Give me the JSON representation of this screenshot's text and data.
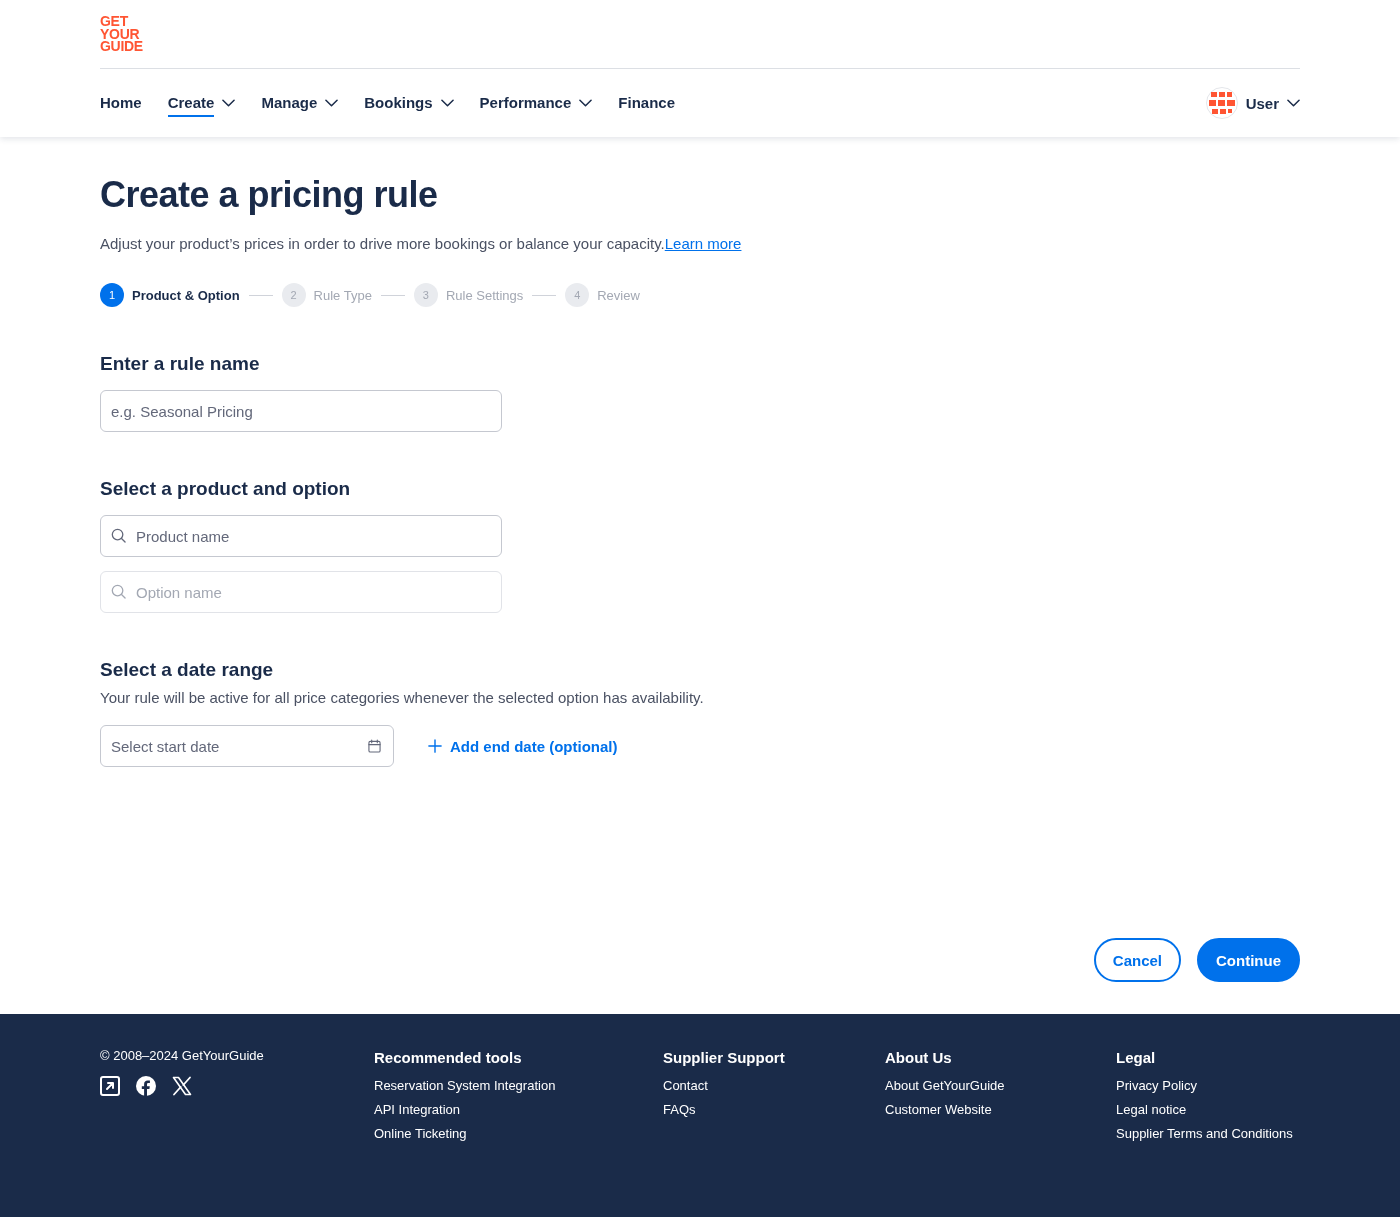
{
  "logo": {
    "lines": [
      "GET",
      "YOUR",
      "GUIDE"
    ]
  },
  "nav": {
    "items": [
      {
        "label": "Home",
        "dropdown": false,
        "selected": false
      },
      {
        "label": "Create",
        "dropdown": true,
        "selected": true
      },
      {
        "label": "Manage",
        "dropdown": true,
        "selected": false
      },
      {
        "label": "Bookings",
        "dropdown": true,
        "selected": false
      },
      {
        "label": "Performance",
        "dropdown": true,
        "selected": false
      },
      {
        "label": "Finance",
        "dropdown": false,
        "selected": false
      }
    ],
    "user": {
      "label": "User",
      "dropdown": true
    }
  },
  "page": {
    "title": "Create a pricing rule",
    "intro": "Adjust your product’s prices in order to drive more bookings or balance your capacity.",
    "learn_more": "Learn more"
  },
  "steps": [
    {
      "number": "1",
      "label": "Product & Option",
      "selected": true
    },
    {
      "number": "2",
      "label": "Rule Type",
      "selected": false
    },
    {
      "number": "3",
      "label": "Rule Settings",
      "selected": false
    },
    {
      "number": "4",
      "label": "Review",
      "selected": false
    }
  ],
  "sections": [
    {
      "heading": "Enter a rule name",
      "fields": [
        {
          "kind": "text",
          "placeholder": "e.g. Seasonal Pricing",
          "disabled": false
        }
      ]
    },
    {
      "heading": "Select a product and option",
      "fields": [
        {
          "kind": "search",
          "placeholder": "Product name",
          "disabled": false
        },
        {
          "kind": "search",
          "placeholder": "Option name",
          "disabled": true
        }
      ]
    },
    {
      "heading": "Select a date range",
      "description": "Your rule will be active for all price categories whenever the selected option has availability.",
      "fields": [
        {
          "kind": "date",
          "placeholder": "Select start date",
          "disabled": false
        }
      ],
      "link": "Add end date (optional)"
    }
  ],
  "actions": [
    {
      "label": "Cancel",
      "kind": "secondary"
    },
    {
      "label": "Continue",
      "kind": "primary"
    }
  ],
  "footer": {
    "copyright": "© 2008–2024 GetYourGuide",
    "social": [
      {
        "kind": "external"
      },
      {
        "kind": "facebook"
      },
      {
        "kind": "x"
      }
    ],
    "columns": [
      {
        "heading": "Recommended tools",
        "links": [
          "Reservation System Integration",
          "API Integration",
          "Online Ticketing"
        ]
      },
      {
        "heading": "Supplier Support",
        "links": [
          "Contact",
          "FAQs"
        ]
      },
      {
        "heading": "About Us",
        "links": [
          "About GetYourGuide",
          "Customer Website"
        ]
      },
      {
        "heading": "Legal",
        "links": [
          "Privacy Policy",
          "Legal notice",
          "Supplier Terms and Conditions"
        ]
      }
    ]
  }
}
